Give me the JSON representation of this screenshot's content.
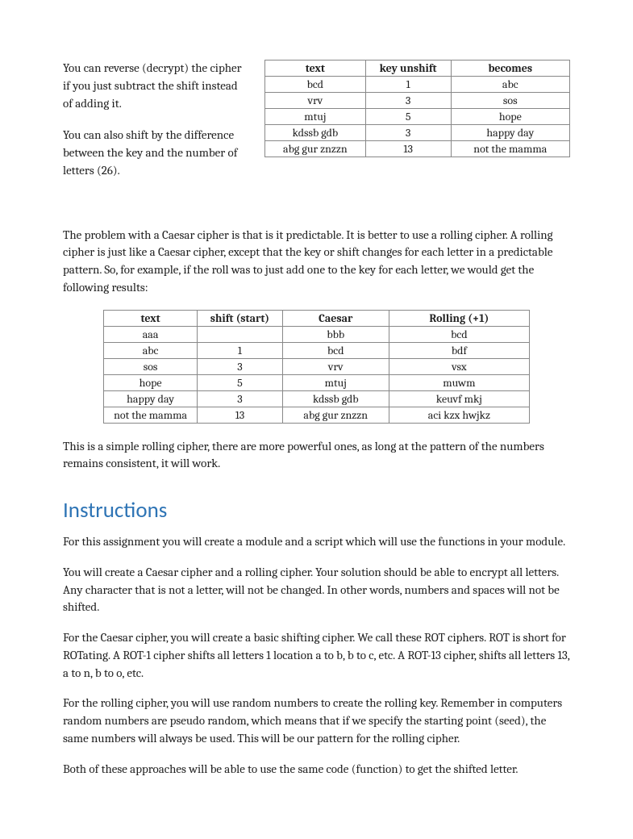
{
  "intro": {
    "p1": "You can reverse (decrypt) the cipher if you just subtract the shift instead of adding it.",
    "p2": "You can also shift by the difference between the key and the number of letters (26)."
  },
  "table1": {
    "headers": [
      "text",
      "key unshift",
      "becomes"
    ],
    "rows": [
      [
        "bcd",
        "1",
        "abc"
      ],
      [
        "vrv",
        "3",
        "sos"
      ],
      [
        "mtuj",
        "5",
        "hope"
      ],
      [
        "kdssb gdb",
        "3",
        "happy day"
      ],
      [
        "abg gur znzzn",
        "13",
        "not the mamma"
      ]
    ]
  },
  "mid": {
    "p1": "The problem with a Caesar cipher is that is it predictable. It is better to use a rolling cipher. A rolling cipher is just like a Caesar cipher, except that the key or shift changes for each letter in a predictable pattern. So, for example, if the roll was to just add one to the key for each letter, we would get the following results:"
  },
  "table2": {
    "headers": [
      "text",
      "shift (start)",
      "Caesar",
      "Rolling (+1)"
    ],
    "rows": [
      [
        "aaa",
        "",
        "bbb",
        "bcd"
      ],
      [
        "abc",
        "1",
        "bcd",
        "bdf"
      ],
      [
        "sos",
        "3",
        "vrv",
        "vsx"
      ],
      [
        "hope",
        "5",
        "mtuj",
        "muwm"
      ],
      [
        "happy day",
        "3",
        "kdssb gdb",
        "keuvf mkj"
      ],
      [
        "not the mamma",
        "13",
        "abg gur znzzn",
        "aci kzx hwjkz"
      ]
    ]
  },
  "post_table": "This is a simple rolling cipher, there are more powerful ones, as long at the pattern of the numbers remains consistent, it will work.",
  "heading": "Instructions",
  "instr": {
    "p1": "For this assignment you will create a module and a script which will use the functions in your module.",
    "p2": "You will create a Caesar cipher and a rolling cipher. Your solution should be able to encrypt all letters. Any character that is not a letter, will not be changed. In other words, numbers and spaces will not be shifted.",
    "p3": "For the Caesar cipher, you will create a basic shifting cipher. We call these ROT ciphers. ROT is short for ROTating. A ROT-1 cipher shifts all letters 1 location a to b, b to c, etc. A ROT-13 cipher, shifts all letters 13, a to n, b to o, etc.",
    "p4": "For the rolling cipher, you will use random numbers to create the rolling key. Remember in computers random numbers are pseudo random, which means that if we specify the starting point (seed), the same numbers will always be used. This will be our pattern for the rolling cipher.",
    "p5": "Both of these approaches will be able to use the same code (function) to get the shifted letter."
  },
  "chart_data": [
    {
      "type": "table",
      "title": "Decrypt / unshift examples",
      "columns": [
        "text",
        "key unshift",
        "becomes"
      ],
      "rows": [
        [
          "bcd",
          1,
          "abc"
        ],
        [
          "vrv",
          3,
          "sos"
        ],
        [
          "mtuj",
          5,
          "hope"
        ],
        [
          "kdssb gdb",
          3,
          "happy day"
        ],
        [
          "abg gur znzzn",
          13,
          "not the mamma"
        ]
      ]
    },
    {
      "type": "table",
      "title": "Caesar vs Rolling (+1) cipher results",
      "columns": [
        "text",
        "shift (start)",
        "Caesar",
        "Rolling (+1)"
      ],
      "rows": [
        [
          "aaa",
          null,
          "bbb",
          "bcd"
        ],
        [
          "abc",
          1,
          "bcd",
          "bdf"
        ],
        [
          "sos",
          3,
          "vrv",
          "vsx"
        ],
        [
          "hope",
          5,
          "mtuj",
          "muwm"
        ],
        [
          "happy day",
          3,
          "kdssb gdb",
          "keuvf mkj"
        ],
        [
          "not the mamma",
          13,
          "abg gur znzzn",
          "aci kzx hwjkz"
        ]
      ]
    }
  ]
}
